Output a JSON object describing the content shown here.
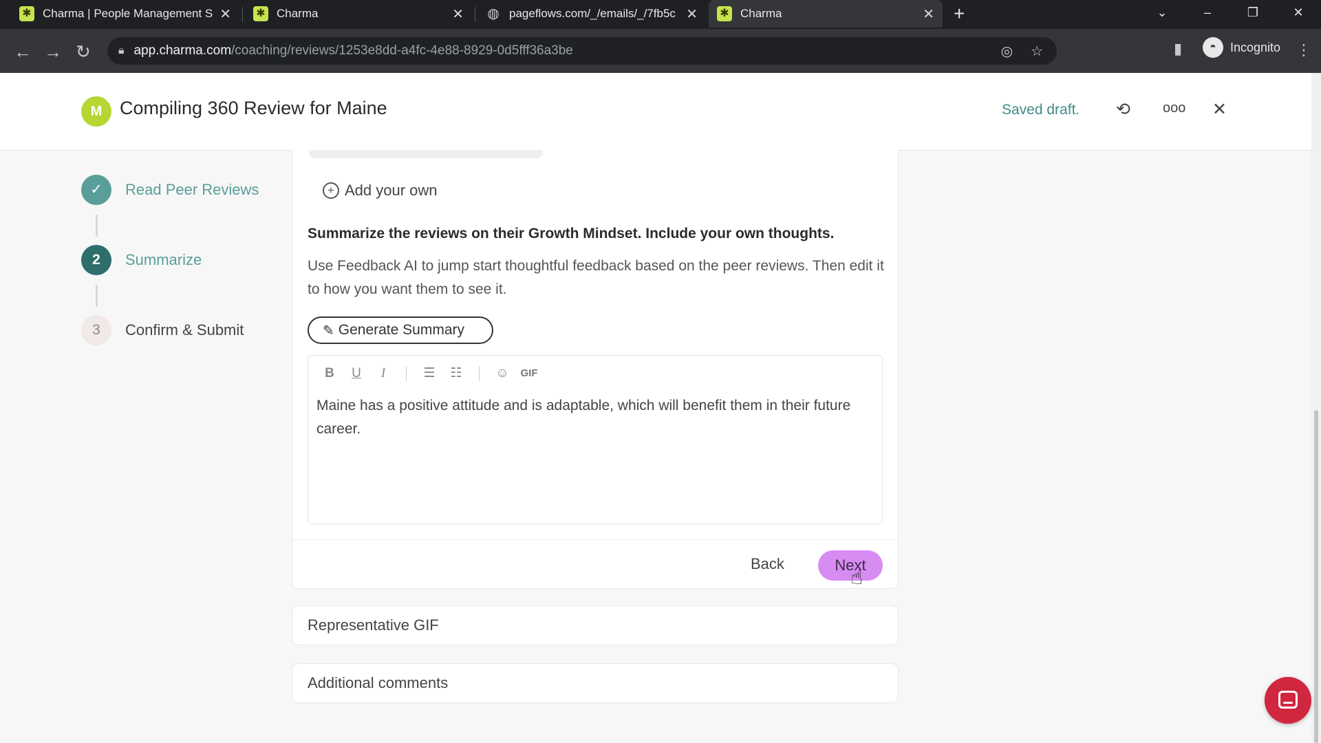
{
  "browser": {
    "tabs": [
      {
        "title": "Charma | People Management S",
        "favicon": "charma-icon",
        "active": false
      },
      {
        "title": "Charma",
        "favicon": "charma-icon",
        "active": false
      },
      {
        "title": "pageflows.com/_/emails/_/7fb5c",
        "favicon": "globe-icon",
        "active": false
      },
      {
        "title": "Charma",
        "favicon": "charma-icon",
        "active": true
      }
    ],
    "url_host": "app.charma.com",
    "url_path": "/coaching/reviews/1253e8dd-a4fc-4e88-8929-0d5fff36a3be",
    "profile_label": "Incognito"
  },
  "header": {
    "avatar_letter": "M",
    "title": "Compiling 360 Review for Maine",
    "status": "Saved draft."
  },
  "stepper": {
    "steps": [
      {
        "number": "✓",
        "label": "Read Peer Reviews",
        "state": "done"
      },
      {
        "number": "2",
        "label": "Summarize",
        "state": "current"
      },
      {
        "number": "3",
        "label": "Confirm & Submit",
        "state": "todo"
      }
    ]
  },
  "main": {
    "add_own_label": "Add your own",
    "prompt": "Summarize the reviews on their Growth Mindset. Include your own thoughts.",
    "helper": "Use Feedback AI to jump start thoughtful feedback based on the peer reviews. Then edit it to how you want them to see it.",
    "generate_label": "Generate Summary",
    "toolbar": {
      "gif_label": "GIF"
    },
    "editor_text": "Maine has a positive attitude and is adaptable, which will benefit them in their future career.",
    "back_label": "Back",
    "next_label": "Next"
  },
  "sections": [
    {
      "label": "Representative GIF"
    },
    {
      "label": "Additional comments"
    }
  ],
  "colors": {
    "accent_teal": "#5a9e99",
    "next_button": "#d78cf2",
    "avatar": "#b6d634",
    "chat_launcher": "#d1263f"
  }
}
